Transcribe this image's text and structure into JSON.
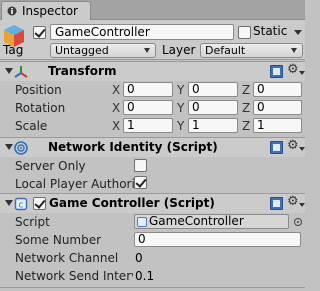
{
  "tab": {
    "label": "Inspector"
  },
  "header": {
    "active": true,
    "name": "GameController",
    "static_label": "Static",
    "tag_label": "Tag",
    "tag_value": "Untagged",
    "layer_label": "Layer",
    "layer_value": "Default"
  },
  "transform": {
    "title": "Transform",
    "position": {
      "label": "Position",
      "x": "0",
      "y": "0",
      "z": "0"
    },
    "rotation": {
      "label": "Rotation",
      "x": "0",
      "y": "0",
      "z": "0"
    },
    "scale": {
      "label": "Scale",
      "x": "1",
      "y": "1",
      "z": "1"
    },
    "axis_x": "X",
    "axis_y": "Y",
    "axis_z": "Z"
  },
  "network_identity": {
    "title": "Network Identity (Script)",
    "server_only_label": "Server Only",
    "server_only": false,
    "local_player_label": "Local Player Authorit",
    "local_player": true
  },
  "game_controller": {
    "title": "Game Controller (Script)",
    "enabled": true,
    "script_label": "Script",
    "script_value": "GameController",
    "some_number_label": "Some Number",
    "some_number_value": "0",
    "channel_label": "Network Channel",
    "channel_value": "0",
    "send_interval_label": "Network Send Interv",
    "send_interval_value": "0.1"
  },
  "colors": {
    "panel_bg": "#c2c2c2",
    "header_bg": "#cbcbcb",
    "transform_icon_red": "#d13b2e",
    "network_icon_blue": "#2f6fc2"
  }
}
